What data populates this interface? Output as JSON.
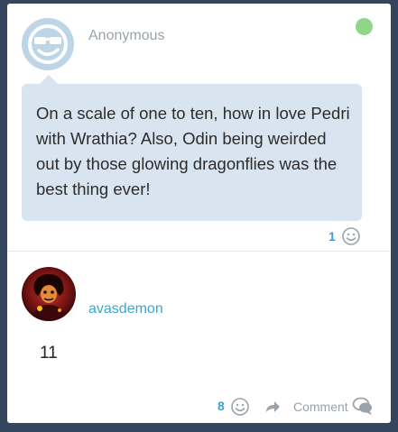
{
  "question": {
    "asker": "Anonymous",
    "avatar_icon": "anonymous-sunglasses-icon",
    "online_status_color": "#8fd687",
    "text": "On a scale of one to ten, how in love Pedri with Wrathia? Also, Odin being weirded out by those glowing dragonflies was the best thing ever!",
    "like_count": "1",
    "like_icon": "smiley-icon"
  },
  "answer": {
    "author": "avasdemon",
    "avatar_icon": "demon-avatar",
    "text": "11",
    "like_count": "8",
    "like_icon": "smiley-icon",
    "share_icon": "share-arrow-icon",
    "comment_label": "Comment",
    "comment_icon": "speech-bubble-icon"
  },
  "colors": {
    "background": "#34465d",
    "bubble": "#d8e5f0",
    "accent": "#3fa5cf"
  }
}
